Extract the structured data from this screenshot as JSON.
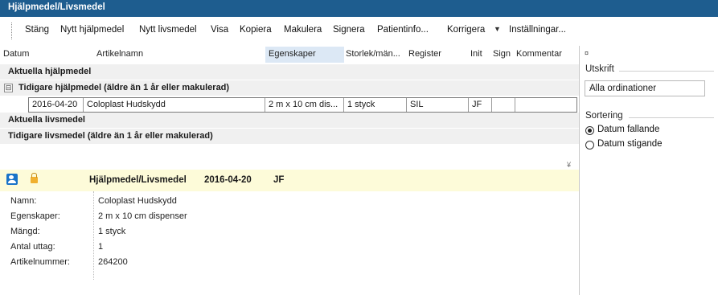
{
  "window": {
    "title": "Hjälpmedel/Livsmedel"
  },
  "toolbar": {
    "items": [
      "Stäng",
      "Nytt hjälpmedel",
      "Nytt livsmedel",
      "Visa",
      "Kopiera",
      "Makulera",
      "Signera",
      "Patientinfo...",
      "Korrigera",
      "Inställningar..."
    ],
    "dropdown_glyph": "▼"
  },
  "grid": {
    "columns": [
      "Datum",
      "Artikelnamn",
      "Egenskaper",
      "Storlek/män...",
      "Register",
      "Init",
      "Sign",
      "Kommentar"
    ],
    "sorted_column": "Egenskaper",
    "groups": [
      {
        "label": "Aktuella hjälpmedel",
        "expander": ""
      },
      {
        "label": "Tidigare hjälpmedel (äldre än 1 år eller makulerad)",
        "expander": "⊟"
      },
      {
        "label": "Aktuella livsmedel",
        "expander": ""
      },
      {
        "label": "Tidigare livsmedel (äldre än 1 år eller makulerad)",
        "expander": ""
      }
    ],
    "rows": [
      {
        "datum": "2016-04-20",
        "artikelnamn": "Coloplast Hudskydd",
        "egenskaper": "2 m x 10 cm dis...",
        "storlek": "1 styck",
        "register": "SIL",
        "init": "JF",
        "sign": "",
        "kommentar": ""
      }
    ],
    "scroll_glyph": "¥"
  },
  "detail": {
    "header": {
      "title": "Hjälpmedel/Livsmedel",
      "date": "2016-04-20",
      "init": "JF"
    },
    "fields": [
      {
        "label": "Namn:",
        "value": "Coloplast Hudskydd"
      },
      {
        "label": "Egenskaper:",
        "value": "2 m x 10 cm dispenser"
      },
      {
        "label": "Mängd:",
        "value": "1 styck"
      },
      {
        "label": "Antal uttag:",
        "value": "1"
      },
      {
        "label": "Artikelnummer:",
        "value": "264200"
      }
    ]
  },
  "side_panel": {
    "pin_glyph": "¤",
    "print_title": "Utskrift",
    "print_select": "Alla ordinationer",
    "sort_title": "Sortering",
    "sort_options": [
      "Datum fallande",
      "Datum stigande"
    ],
    "sort_selected": 0
  },
  "colors": {
    "titlebar": "#1e5d8f",
    "detail_header": "#fdfbd9",
    "sorted_column": "#dce8f5",
    "group_row": "#f0f0f0"
  }
}
